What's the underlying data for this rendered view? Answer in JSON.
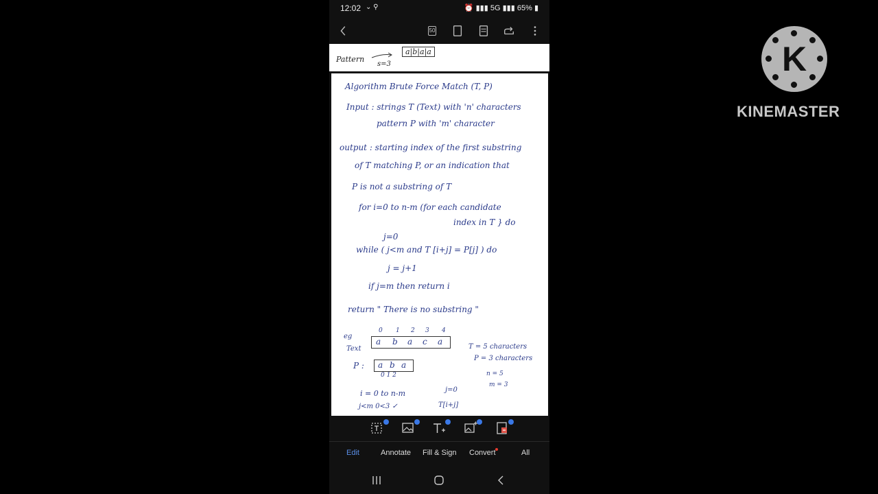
{
  "status_bar": {
    "time": "12:02",
    "battery": "65%",
    "network": "5G"
  },
  "toolbar": {
    "icons": [
      "back-icon",
      "page-count-icon",
      "single-page-icon",
      "reading-mode-icon",
      "share-icon",
      "more-icon"
    ],
    "page_count": "50"
  },
  "document": {
    "strip": {
      "pattern_label": "Pattern",
      "pattern_cells": "a|b|a|a",
      "s_label": "s=3"
    },
    "lines": [
      "Algorithm  Brute Force Match  (T, P)",
      "Input : strings  T (Text)  with 'n' characters",
      "pattern  P  with 'm' character",
      "output : starting index of the first substring",
      "of T matching P, or an indication that",
      "P is not a substring of T",
      "for  i=0 to n-m  (for each candidate",
      "index in T } do",
      "j=0",
      "while ( j<m and T [i+j] = P[j] ) do",
      "j = j+1",
      "if  j=m  then  return i",
      "return  \" There is no substring \""
    ],
    "example": {
      "eg_label": "eg",
      "text_label": "Text",
      "text_indices": [
        "0",
        "1",
        "2",
        "3",
        "4"
      ],
      "text_cells": [
        "a",
        "b",
        "a",
        "c",
        "a"
      ],
      "p_label": "P :",
      "p_cells": [
        "a",
        "b",
        "a"
      ],
      "p_indices": "0  1  2",
      "notes": [
        "T = 5 characters",
        "P = 3 characters",
        "n = 5",
        "m = 3"
      ],
      "bottom_lines": [
        "i = 0 to n-m",
        "j=0",
        "j<m   0<3 ✓",
        "T[i+j]"
      ]
    }
  },
  "edit_tools": {
    "icons": [
      "edit-text-icon",
      "edit-image-icon",
      "add-text-icon",
      "add-image-icon",
      "delete-page-icon"
    ]
  },
  "bottom_tabs": [
    "Edit",
    "Annotate",
    "Fill & Sign",
    "Convert",
    "All"
  ],
  "watermark": {
    "logo_letter": "K",
    "brand": "KINEMASTER"
  },
  "colors": {
    "background": "#000000",
    "accent": "#5b8fe8",
    "ink": "#2a3a8a"
  }
}
